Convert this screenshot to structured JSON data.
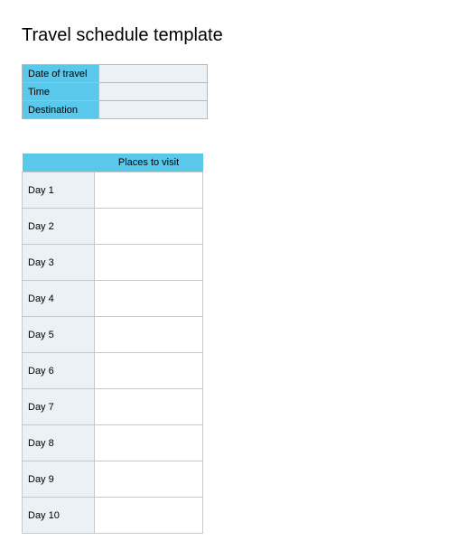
{
  "title": "Travel schedule template",
  "info": {
    "rows": [
      {
        "label": "Date of travel",
        "value": ""
      },
      {
        "label": "Time",
        "value": ""
      },
      {
        "label": "Destination",
        "value": ""
      }
    ]
  },
  "schedule": {
    "header": "Places to visit",
    "days": [
      {
        "label": "Day 1",
        "value": ""
      },
      {
        "label": "Day 2",
        "value": ""
      },
      {
        "label": "Day 3",
        "value": ""
      },
      {
        "label": "Day 4",
        "value": ""
      },
      {
        "label": "Day 5",
        "value": ""
      },
      {
        "label": "Day 6",
        "value": ""
      },
      {
        "label": "Day 7",
        "value": ""
      },
      {
        "label": "Day 8",
        "value": ""
      },
      {
        "label": "Day 9",
        "value": ""
      },
      {
        "label": "Day 10",
        "value": ""
      }
    ]
  }
}
